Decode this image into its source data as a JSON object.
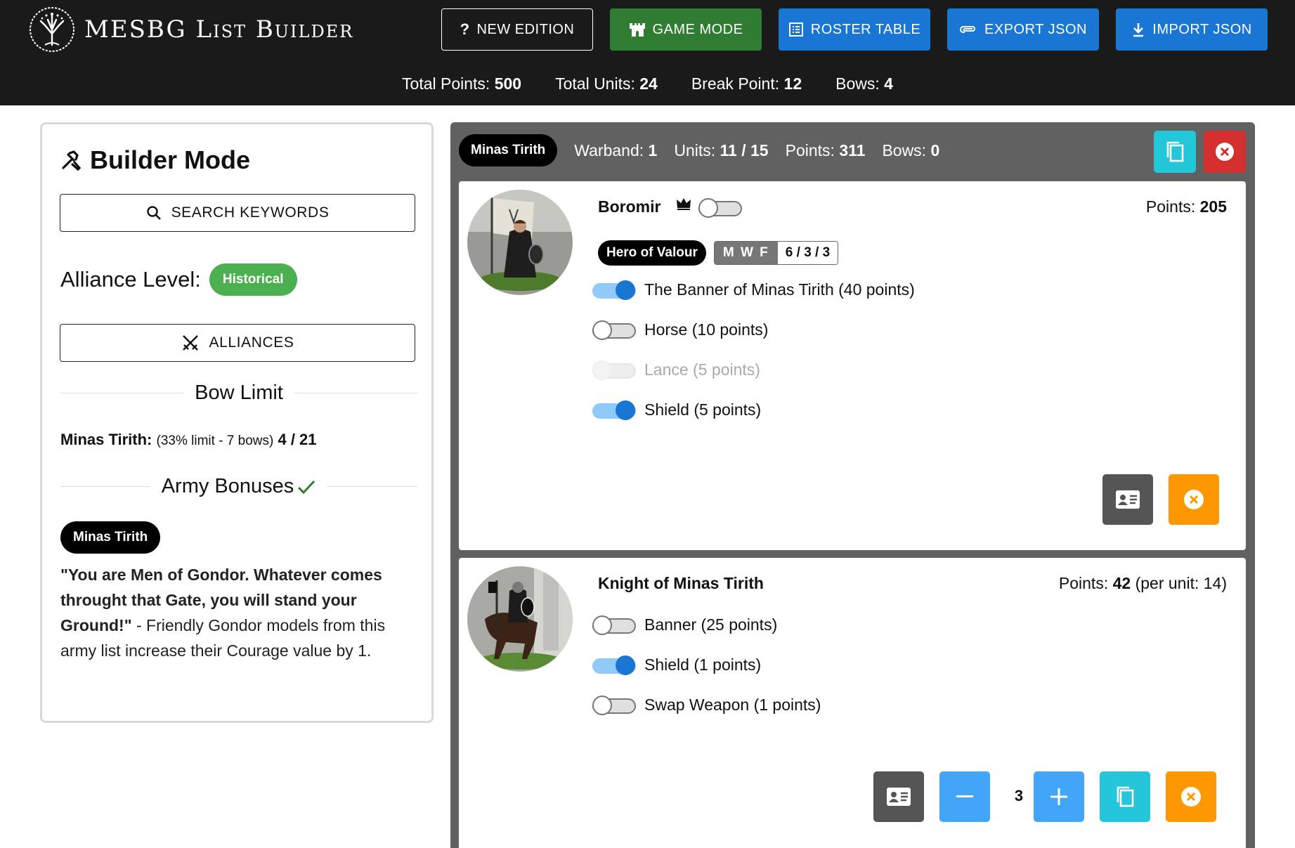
{
  "app": {
    "title": "MESBG List Builder"
  },
  "nav": {
    "new_edition": "NEW EDITION",
    "game_mode": "GAME MODE",
    "roster_table": "ROSTER TABLE",
    "export_json": "EXPORT JSON",
    "import_json": "IMPORT JSON"
  },
  "totals": {
    "points_label": "Total Points:",
    "points": "500",
    "units_label": "Total Units:",
    "units": "24",
    "break_label": "Break Point:",
    "break_point": "12",
    "bows_label": "Bows:",
    "bows": "4"
  },
  "builder": {
    "title": "Builder Mode",
    "search_label": "SEARCH KEYWORDS",
    "alliance_label": "Alliance Level:",
    "alliance_value": "Historical",
    "alliances_button": "ALLIANCES",
    "bow_limit_title": "Bow Limit",
    "bow_faction": "Minas Tirith:",
    "bow_note": "(33% limit - 7 bows)",
    "bow_count": "4 / 21",
    "bonuses_title": "Army Bonuses",
    "bonus_faction": "Minas Tirith",
    "bonus_quote": "\"You are Men of Gondor. Whatever comes throught that Gate, you will stand your Ground!\"",
    "bonus_text": " - Friendly Gondor models from this army list increase their Courage value by 1."
  },
  "warband": {
    "faction": "Minas Tirith",
    "warband_label": "Warband:",
    "warband_no": "1",
    "units_label": "Units:",
    "units": "11 / 15",
    "points_label": "Points:",
    "points": "311",
    "bows_label": "Bows:",
    "bows": "0"
  },
  "units": [
    {
      "name": "Boromir",
      "points_label": "Points:",
      "points": "205",
      "per_unit": "",
      "hero_tier": "Hero of Valour",
      "mwf_label": "M W F",
      "mwf_value": "6 / 3 / 3",
      "options": [
        {
          "label": "The Banner of Minas Tirith (40 points)",
          "state": "on"
        },
        {
          "label": "Horse (10 points)",
          "state": "off"
        },
        {
          "label": "Lance (5 points)",
          "state": "disabled"
        },
        {
          "label": "Shield (5 points)",
          "state": "on"
        }
      ]
    },
    {
      "name": "Knight of Minas Tirith",
      "points_label": "Points:",
      "points": "42",
      "per_unit": "(per unit: 14)",
      "quantity": "3",
      "options": [
        {
          "label": "Banner (25 points)",
          "state": "off"
        },
        {
          "label": "Shield (1 points)",
          "state": "on"
        },
        {
          "label": "Swap Weapon (1 points)",
          "state": "off"
        }
      ]
    }
  ],
  "colors": {
    "header_bg": "#1a1a1a",
    "game_mode": "#2e7d32",
    "primary": "#1976d2",
    "success": "#4caf50",
    "warband_bg": "#616161",
    "cyan": "#26c6da",
    "danger": "#d32f2f",
    "warning": "#ff9800"
  }
}
